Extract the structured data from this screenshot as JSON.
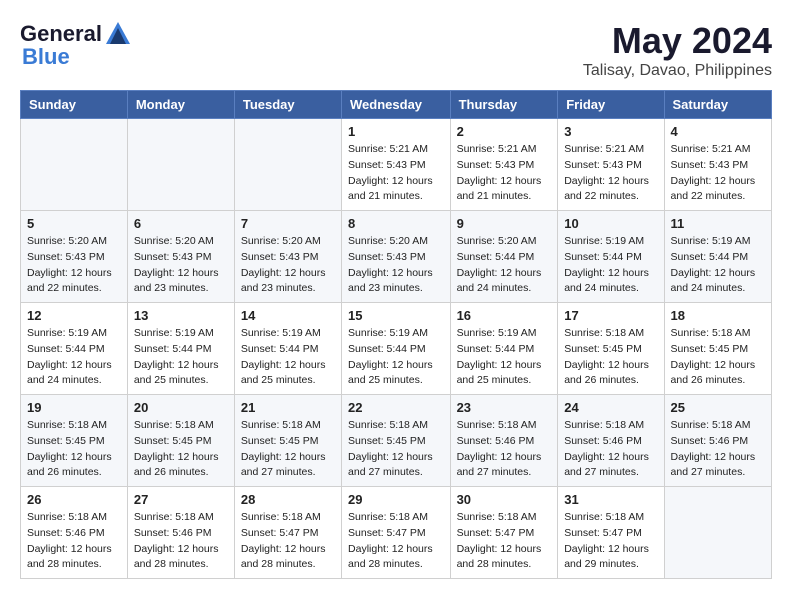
{
  "logo": {
    "general": "General",
    "blue": "Blue"
  },
  "title": "May 2024",
  "subtitle": "Talisay, Davao, Philippines",
  "days": [
    "Sunday",
    "Monday",
    "Tuesday",
    "Wednesday",
    "Thursday",
    "Friday",
    "Saturday"
  ],
  "weeks": [
    [
      {
        "day": "",
        "info": ""
      },
      {
        "day": "",
        "info": ""
      },
      {
        "day": "",
        "info": ""
      },
      {
        "day": "1",
        "info": "Sunrise: 5:21 AM\nSunset: 5:43 PM\nDaylight: 12 hours\nand 21 minutes."
      },
      {
        "day": "2",
        "info": "Sunrise: 5:21 AM\nSunset: 5:43 PM\nDaylight: 12 hours\nand 21 minutes."
      },
      {
        "day": "3",
        "info": "Sunrise: 5:21 AM\nSunset: 5:43 PM\nDaylight: 12 hours\nand 22 minutes."
      },
      {
        "day": "4",
        "info": "Sunrise: 5:21 AM\nSunset: 5:43 PM\nDaylight: 12 hours\nand 22 minutes."
      }
    ],
    [
      {
        "day": "5",
        "info": "Sunrise: 5:20 AM\nSunset: 5:43 PM\nDaylight: 12 hours\nand 22 minutes."
      },
      {
        "day": "6",
        "info": "Sunrise: 5:20 AM\nSunset: 5:43 PM\nDaylight: 12 hours\nand 23 minutes."
      },
      {
        "day": "7",
        "info": "Sunrise: 5:20 AM\nSunset: 5:43 PM\nDaylight: 12 hours\nand 23 minutes."
      },
      {
        "day": "8",
        "info": "Sunrise: 5:20 AM\nSunset: 5:43 PM\nDaylight: 12 hours\nand 23 minutes."
      },
      {
        "day": "9",
        "info": "Sunrise: 5:20 AM\nSunset: 5:44 PM\nDaylight: 12 hours\nand 24 minutes."
      },
      {
        "day": "10",
        "info": "Sunrise: 5:19 AM\nSunset: 5:44 PM\nDaylight: 12 hours\nand 24 minutes."
      },
      {
        "day": "11",
        "info": "Sunrise: 5:19 AM\nSunset: 5:44 PM\nDaylight: 12 hours\nand 24 minutes."
      }
    ],
    [
      {
        "day": "12",
        "info": "Sunrise: 5:19 AM\nSunset: 5:44 PM\nDaylight: 12 hours\nand 24 minutes."
      },
      {
        "day": "13",
        "info": "Sunrise: 5:19 AM\nSunset: 5:44 PM\nDaylight: 12 hours\nand 25 minutes."
      },
      {
        "day": "14",
        "info": "Sunrise: 5:19 AM\nSunset: 5:44 PM\nDaylight: 12 hours\nand 25 minutes."
      },
      {
        "day": "15",
        "info": "Sunrise: 5:19 AM\nSunset: 5:44 PM\nDaylight: 12 hours\nand 25 minutes."
      },
      {
        "day": "16",
        "info": "Sunrise: 5:19 AM\nSunset: 5:44 PM\nDaylight: 12 hours\nand 25 minutes."
      },
      {
        "day": "17",
        "info": "Sunrise: 5:18 AM\nSunset: 5:45 PM\nDaylight: 12 hours\nand 26 minutes."
      },
      {
        "day": "18",
        "info": "Sunrise: 5:18 AM\nSunset: 5:45 PM\nDaylight: 12 hours\nand 26 minutes."
      }
    ],
    [
      {
        "day": "19",
        "info": "Sunrise: 5:18 AM\nSunset: 5:45 PM\nDaylight: 12 hours\nand 26 minutes."
      },
      {
        "day": "20",
        "info": "Sunrise: 5:18 AM\nSunset: 5:45 PM\nDaylight: 12 hours\nand 26 minutes."
      },
      {
        "day": "21",
        "info": "Sunrise: 5:18 AM\nSunset: 5:45 PM\nDaylight: 12 hours\nand 27 minutes."
      },
      {
        "day": "22",
        "info": "Sunrise: 5:18 AM\nSunset: 5:45 PM\nDaylight: 12 hours\nand 27 minutes."
      },
      {
        "day": "23",
        "info": "Sunrise: 5:18 AM\nSunset: 5:46 PM\nDaylight: 12 hours\nand 27 minutes."
      },
      {
        "day": "24",
        "info": "Sunrise: 5:18 AM\nSunset: 5:46 PM\nDaylight: 12 hours\nand 27 minutes."
      },
      {
        "day": "25",
        "info": "Sunrise: 5:18 AM\nSunset: 5:46 PM\nDaylight: 12 hours\nand 27 minutes."
      }
    ],
    [
      {
        "day": "26",
        "info": "Sunrise: 5:18 AM\nSunset: 5:46 PM\nDaylight: 12 hours\nand 28 minutes."
      },
      {
        "day": "27",
        "info": "Sunrise: 5:18 AM\nSunset: 5:46 PM\nDaylight: 12 hours\nand 28 minutes."
      },
      {
        "day": "28",
        "info": "Sunrise: 5:18 AM\nSunset: 5:47 PM\nDaylight: 12 hours\nand 28 minutes."
      },
      {
        "day": "29",
        "info": "Sunrise: 5:18 AM\nSunset: 5:47 PM\nDaylight: 12 hours\nand 28 minutes."
      },
      {
        "day": "30",
        "info": "Sunrise: 5:18 AM\nSunset: 5:47 PM\nDaylight: 12 hours\nand 28 minutes."
      },
      {
        "day": "31",
        "info": "Sunrise: 5:18 AM\nSunset: 5:47 PM\nDaylight: 12 hours\nand 29 minutes."
      },
      {
        "day": "",
        "info": ""
      }
    ]
  ]
}
